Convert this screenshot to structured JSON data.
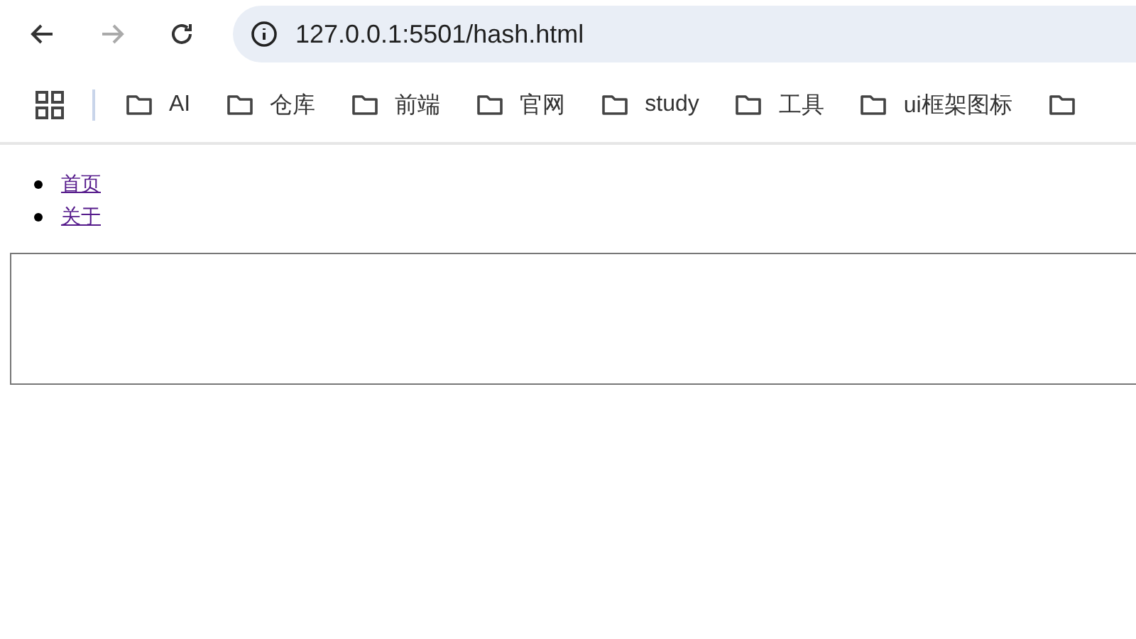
{
  "address_bar": {
    "url": "127.0.0.1:5501/hash.html"
  },
  "bookmarks": [
    {
      "label": "AI"
    },
    {
      "label": "仓库"
    },
    {
      "label": "前端"
    },
    {
      "label": "官网"
    },
    {
      "label": "study"
    },
    {
      "label": "工具"
    },
    {
      "label": "ui框架图标"
    }
  ],
  "page": {
    "links": [
      {
        "label": "首页"
      },
      {
        "label": "关于"
      }
    ]
  }
}
